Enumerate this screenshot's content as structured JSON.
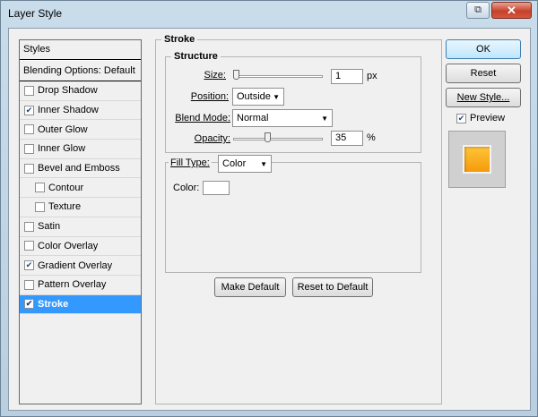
{
  "window": {
    "title": "Layer Style",
    "close_glyph": "✕",
    "help_glyph": "⧉"
  },
  "styles_panel": {
    "header": "Styles",
    "blending_options": "Blending Options: Default",
    "items": [
      {
        "label": "Drop Shadow",
        "checked": false,
        "sub": false,
        "selected": false
      },
      {
        "label": "Inner Shadow",
        "checked": true,
        "sub": false,
        "selected": false
      },
      {
        "label": "Outer Glow",
        "checked": false,
        "sub": false,
        "selected": false
      },
      {
        "label": "Inner Glow",
        "checked": false,
        "sub": false,
        "selected": false
      },
      {
        "label": "Bevel and Emboss",
        "checked": false,
        "sub": false,
        "selected": false
      },
      {
        "label": "Contour",
        "checked": false,
        "sub": true,
        "selected": false
      },
      {
        "label": "Texture",
        "checked": false,
        "sub": true,
        "selected": false
      },
      {
        "label": "Satin",
        "checked": false,
        "sub": false,
        "selected": false
      },
      {
        "label": "Color Overlay",
        "checked": false,
        "sub": false,
        "selected": false
      },
      {
        "label": "Gradient Overlay",
        "checked": true,
        "sub": false,
        "selected": false
      },
      {
        "label": "Pattern Overlay",
        "checked": false,
        "sub": false,
        "selected": false
      },
      {
        "label": "Stroke",
        "checked": true,
        "sub": false,
        "selected": true
      }
    ]
  },
  "stroke": {
    "group_title": "Stroke",
    "structure_title": "Structure",
    "size": {
      "label": "Size:",
      "value": "1",
      "unit": "px",
      "slider_fraction": 0.0
    },
    "position": {
      "label": "Position:",
      "value": "Outside"
    },
    "blend_mode": {
      "label": "Blend Mode:",
      "value": "Normal"
    },
    "opacity": {
      "label": "Opacity:",
      "value": "35",
      "unit": "%",
      "slider_fraction": 0.35
    },
    "fill_type": {
      "label": "Fill Type:",
      "value": "Color"
    },
    "color": {
      "label": "Color:",
      "value_hex": "#ffffff"
    },
    "make_default": "Make Default",
    "reset_to_default": "Reset to Default"
  },
  "actions": {
    "ok": "OK",
    "reset": "Reset",
    "new_style": "New Style...",
    "preview_label": "Preview",
    "preview_checked": true
  },
  "colors": {
    "selection": "#3399ff",
    "preview_top": "#ffc43a",
    "preview_bottom": "#f59b0b"
  },
  "icons": [
    "help-icon",
    "close-icon",
    "checkbox-check-icon",
    "dropdown-arrow-icon",
    "slider-thumb-icon"
  ]
}
